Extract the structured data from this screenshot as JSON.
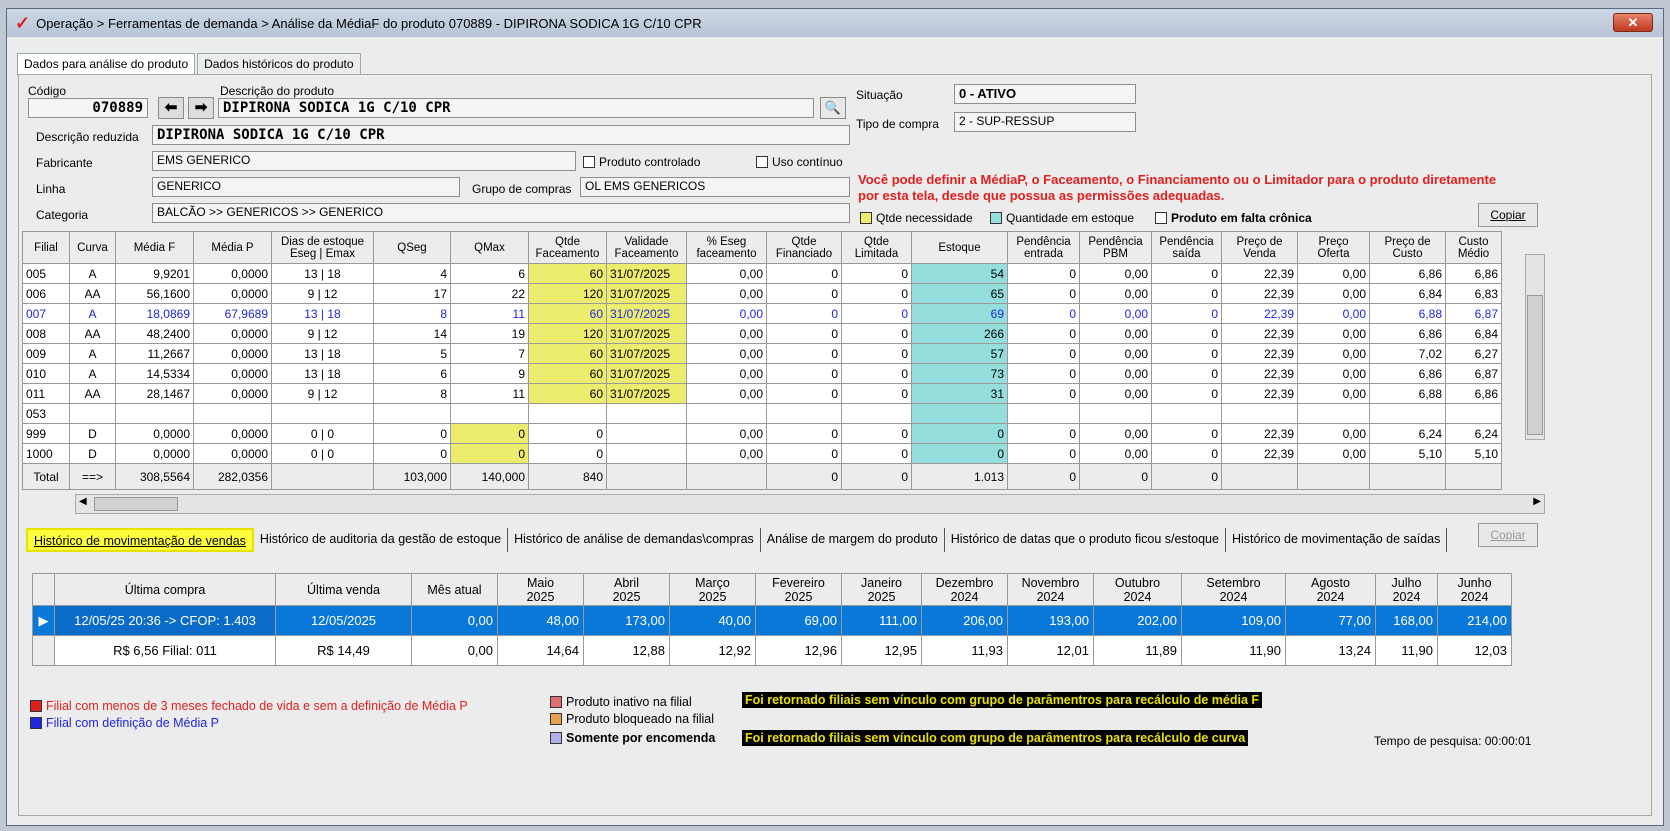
{
  "window": {
    "title": "Operação > Ferramentas de demanda > Análise da MédiaF do produto 070889 - DIPIRONA SODICA 1G C/10 CPR",
    "close": "✕"
  },
  "tabs": [
    "Dados para análise do produto",
    "Dados históricos do produto"
  ],
  "form": {
    "codigo_label": "Código",
    "codigo": "070889",
    "descricao_label": "Descrição do produto",
    "descricao": "DIPIRONA SODICA 1G C/10 CPR",
    "desc_reduzida_label": "Descrição reduzida",
    "desc_reduzida": "DIPIRONA SODICA 1G C/10 CPR",
    "fabricante_label": "Fabricante",
    "fabricante": "EMS GENERICO",
    "linha_label": "Linha",
    "linha": "GENERICO",
    "grupo_label": "Grupo de compras",
    "grupo": "OL EMS GENERICOS",
    "categoria_label": "Categoria",
    "categoria": "BALCÃO >> GENERICOS >> GENERICO",
    "situacao_label": "Situação",
    "situacao": "0 - ATIVO",
    "tipo_label": "Tipo de compra",
    "tipo": "2 - SUP-RESSUP",
    "produto_controlado": "Produto controlado",
    "uso_continuo": "Uso contínuo",
    "warning": "Você pode definir a MédiaP, o Faceamento, o Financiamento ou o Limitador para o produto diretamente por esta tela, desde que possua as permissões adequadas.",
    "legend_qtde": "Qtde necessidade",
    "legend_estoque": "Quantidade em estoque",
    "legend_falta": "Produto em falta crônica",
    "copiar": "Copiar"
  },
  "grid": {
    "headers": [
      "Filial",
      "Curva",
      "Média F",
      "Média P",
      "Dias de estoque\nEseg | Emax",
      "QSeg",
      "QMax",
      "Qtde\nFaceamento",
      "Validade\nFaceamento",
      "% Eseg\nfaceamento",
      "Qtde\nFinanciado",
      "Qtde\nLimitada",
      "Estoque",
      "Pendência\nentrada",
      "Pendência\nPBM",
      "Pendência\nsaída",
      "Preço de\nVenda",
      "Preço\nOferta",
      "Preço de\nCusto",
      "Custo\nMédio"
    ],
    "rows": [
      [
        "005",
        "A",
        "9,9201",
        "0,0000",
        "13  |  18",
        "4",
        "6",
        "60",
        "31/07/2025",
        "0,00",
        "0",
        "0",
        "54",
        "0",
        "0,00",
        "0",
        "22,39",
        "0,00",
        "6,86",
        "6,86"
      ],
      [
        "006",
        "AA",
        "56,1600",
        "0,0000",
        "9  |  12",
        "17",
        "22",
        "120",
        "31/07/2025",
        "0,00",
        "0",
        "0",
        "65",
        "0",
        "0,00",
        "0",
        "22,39",
        "0,00",
        "6,84",
        "6,83"
      ],
      [
        "007",
        "A",
        "18,0869",
        "67,9689",
        "13  |  18",
        "8",
        "11",
        "60",
        "31/07/2025",
        "0,00",
        "0",
        "0",
        "69",
        "0",
        "0,00",
        "0",
        "22,39",
        "0,00",
        "6,88",
        "6,87"
      ],
      [
        "008",
        "AA",
        "48,2400",
        "0,0000",
        "9  |  12",
        "14",
        "19",
        "120",
        "31/07/2025",
        "0,00",
        "0",
        "0",
        "266",
        "0",
        "0,00",
        "0",
        "22,39",
        "0,00",
        "6,86",
        "6,84"
      ],
      [
        "009",
        "A",
        "11,2667",
        "0,0000",
        "13  |  18",
        "5",
        "7",
        "60",
        "31/07/2025",
        "0,00",
        "0",
        "0",
        "57",
        "0",
        "0,00",
        "0",
        "22,39",
        "0,00",
        "7,02",
        "6,27"
      ],
      [
        "010",
        "A",
        "14,5334",
        "0,0000",
        "13  |  18",
        "6",
        "9",
        "60",
        "31/07/2025",
        "0,00",
        "0",
        "0",
        "73",
        "0",
        "0,00",
        "0",
        "22,39",
        "0,00",
        "6,86",
        "6,87"
      ],
      [
        "011",
        "AA",
        "28,1467",
        "0,0000",
        "9  |  12",
        "8",
        "11",
        "60",
        "31/07/2025",
        "0,00",
        "0",
        "0",
        "31",
        "0",
        "0,00",
        "0",
        "22,39",
        "0,00",
        "6,88",
        "6,86"
      ],
      [
        "053",
        "",
        "",
        "",
        "",
        "",
        "",
        "",
        "",
        "",
        "",
        "",
        "",
        "",
        "",
        "",
        "",
        "",
        "",
        ""
      ],
      [
        "999",
        "D",
        "0,0000",
        "0,0000",
        "0  |  0",
        "0",
        "0",
        "0",
        "",
        "0,00",
        "0",
        "0",
        "0",
        "0",
        "0,00",
        "0",
        "22,39",
        "0,00",
        "6,24",
        "6,24"
      ],
      [
        "1000",
        "D",
        "0,0000",
        "0,0000",
        "0  |  0",
        "0",
        "0",
        "0",
        "",
        "0,00",
        "0",
        "0",
        "0",
        "0",
        "0,00",
        "0",
        "22,39",
        "0,00",
        "5,10",
        "5,10"
      ]
    ],
    "total": [
      "Total",
      "==>",
      "308,5564",
      "282,0356",
      "",
      "103,000",
      "140,000",
      "840",
      "",
      "",
      "0",
      "0",
      "1.013",
      "0",
      "0",
      "0",
      "",
      "",
      "",
      ""
    ]
  },
  "bottom_tabs": [
    "Histórico de movimentação de vendas",
    "Histórico de auditoria da gestão de estoque",
    "Histórico de análise de demandas\\compras",
    "Análise de margem do produto",
    "Histórico de datas que o produto ficou s/estoque",
    "Histórico de movimentação de saídas"
  ],
  "bottom_copiar": "Copiar",
  "hist": {
    "headers": [
      "Última compra",
      "Última venda",
      "Mês atual",
      "Maio\n2025",
      "Abril\n2025",
      "Março\n2025",
      "Fevereiro\n2025",
      "Janeiro\n2025",
      "Dezembro\n2024",
      "Novembro\n2024",
      "Outubro\n2024",
      "Setembro\n2024",
      "Agosto\n2024",
      "Julho\n2024",
      "Junho\n2024"
    ],
    "rows": [
      [
        "12/05/25 20:36 -> CFOP: 1.403",
        "12/05/2025",
        "0,00",
        "48,00",
        "173,00",
        "40,00",
        "69,00",
        "111,00",
        "206,00",
        "193,00",
        "202,00",
        "109,00",
        "77,00",
        "168,00",
        "214,00"
      ],
      [
        "R$ 6,56 Filial: 011",
        "R$ 14,49",
        "0,00",
        "14,64",
        "12,88",
        "12,92",
        "12,96",
        "12,95",
        "11,93",
        "12,01",
        "11,89",
        "11,90",
        "13,24",
        "11,90",
        "12,03"
      ]
    ]
  },
  "legend": {
    "red": "Filial com menos de 3 meses fechado de vida e sem a definição de Média P",
    "blue": "Filial com definição de Média P",
    "inativo": "Produto inativo na filial",
    "bloqueado": "Produto bloqueado na filial",
    "encomenda": "Somente por encomenda",
    "msg1": "Foi retornado filiais sem vínculo com grupo de parâmentros para recálculo de média F",
    "msg2": "Foi retornado filiais sem vínculo com grupo de parâmentros para recálculo de curva",
    "tempo": "Tempo de pesquisa: 00:00:01"
  },
  "colors": {
    "yellow": "#ecec6e",
    "teal": "#94dede",
    "selection": "#0a78d8",
    "red": "#e02020",
    "blue": "#2026e0"
  }
}
